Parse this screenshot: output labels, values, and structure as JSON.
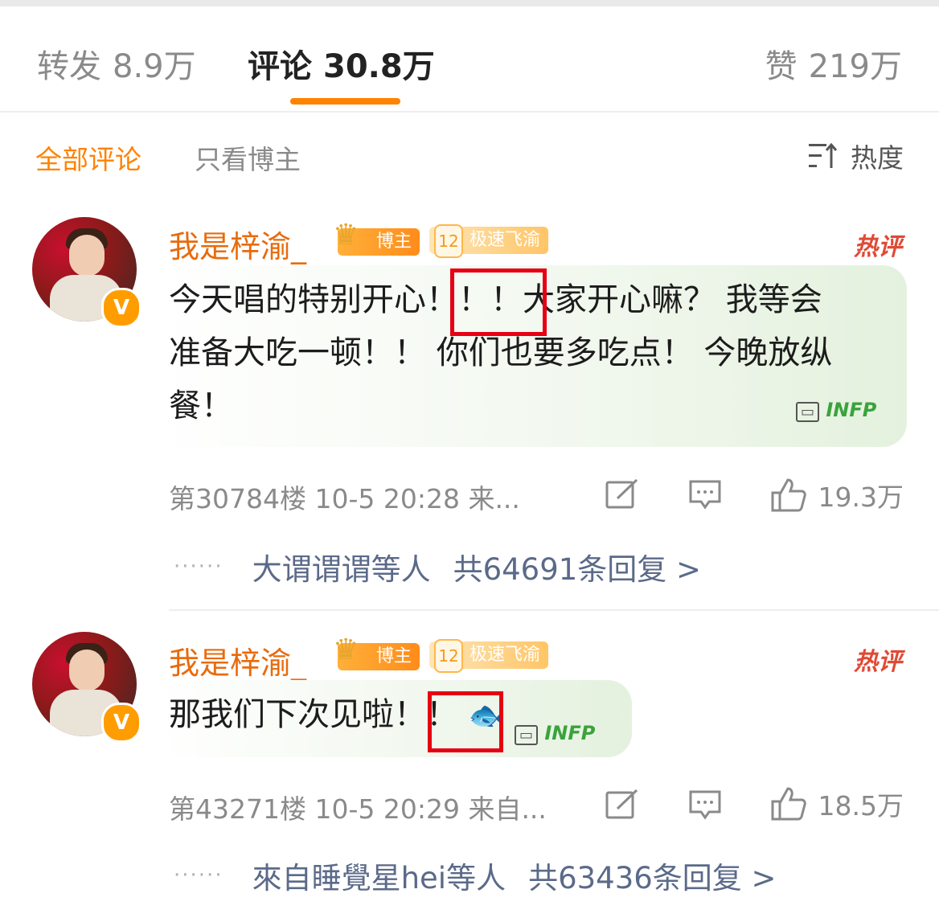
{
  "tabs": {
    "repost": {
      "label": "转发",
      "count": "8.9万"
    },
    "comments": {
      "label": "评论",
      "count": "30.8万"
    },
    "likes": {
      "label": "赞",
      "count": "219万"
    }
  },
  "filters": {
    "all": "全部评论",
    "author_only": "只看博主",
    "sort": "热度"
  },
  "comments": [
    {
      "username": "我是梓渝_",
      "badge_host": "博主",
      "badge_level_num": "12",
      "badge_level": "极速飞渝",
      "hot_label": "热评",
      "text_lines": [
        "今天唱的特别开心！！！大家开心嘛？ 我等会",
        "准备大吃一顿！！ 你们也要多吃点！ 今晚放纵",
        "餐！"
      ],
      "sticker": "INFP",
      "meta": "第30784楼 10-5 20:28 来...",
      "likes": "19.3万",
      "reply_users": "大谓谓谓等人",
      "reply_count": "共64691条回复 >"
    },
    {
      "username": "我是梓渝_",
      "badge_host": "博主",
      "badge_level_num": "12",
      "badge_level": "极速飞渝",
      "hot_label": "热评",
      "text_lines": [
        "那我们下次见啦！！"
      ],
      "emoji": "🐟",
      "sticker": "INFP",
      "meta": "第43271楼 10-5 20:29 来自...",
      "likes": "18.5万",
      "reply_users": "來自睡覺星hei等人",
      "reply_count": "共63436条回复 >"
    }
  ],
  "colors": {
    "accent": "#ff8200",
    "username": "#e86b0c",
    "reply_link": "#5b6a89",
    "highlight_box": "#e60012"
  }
}
